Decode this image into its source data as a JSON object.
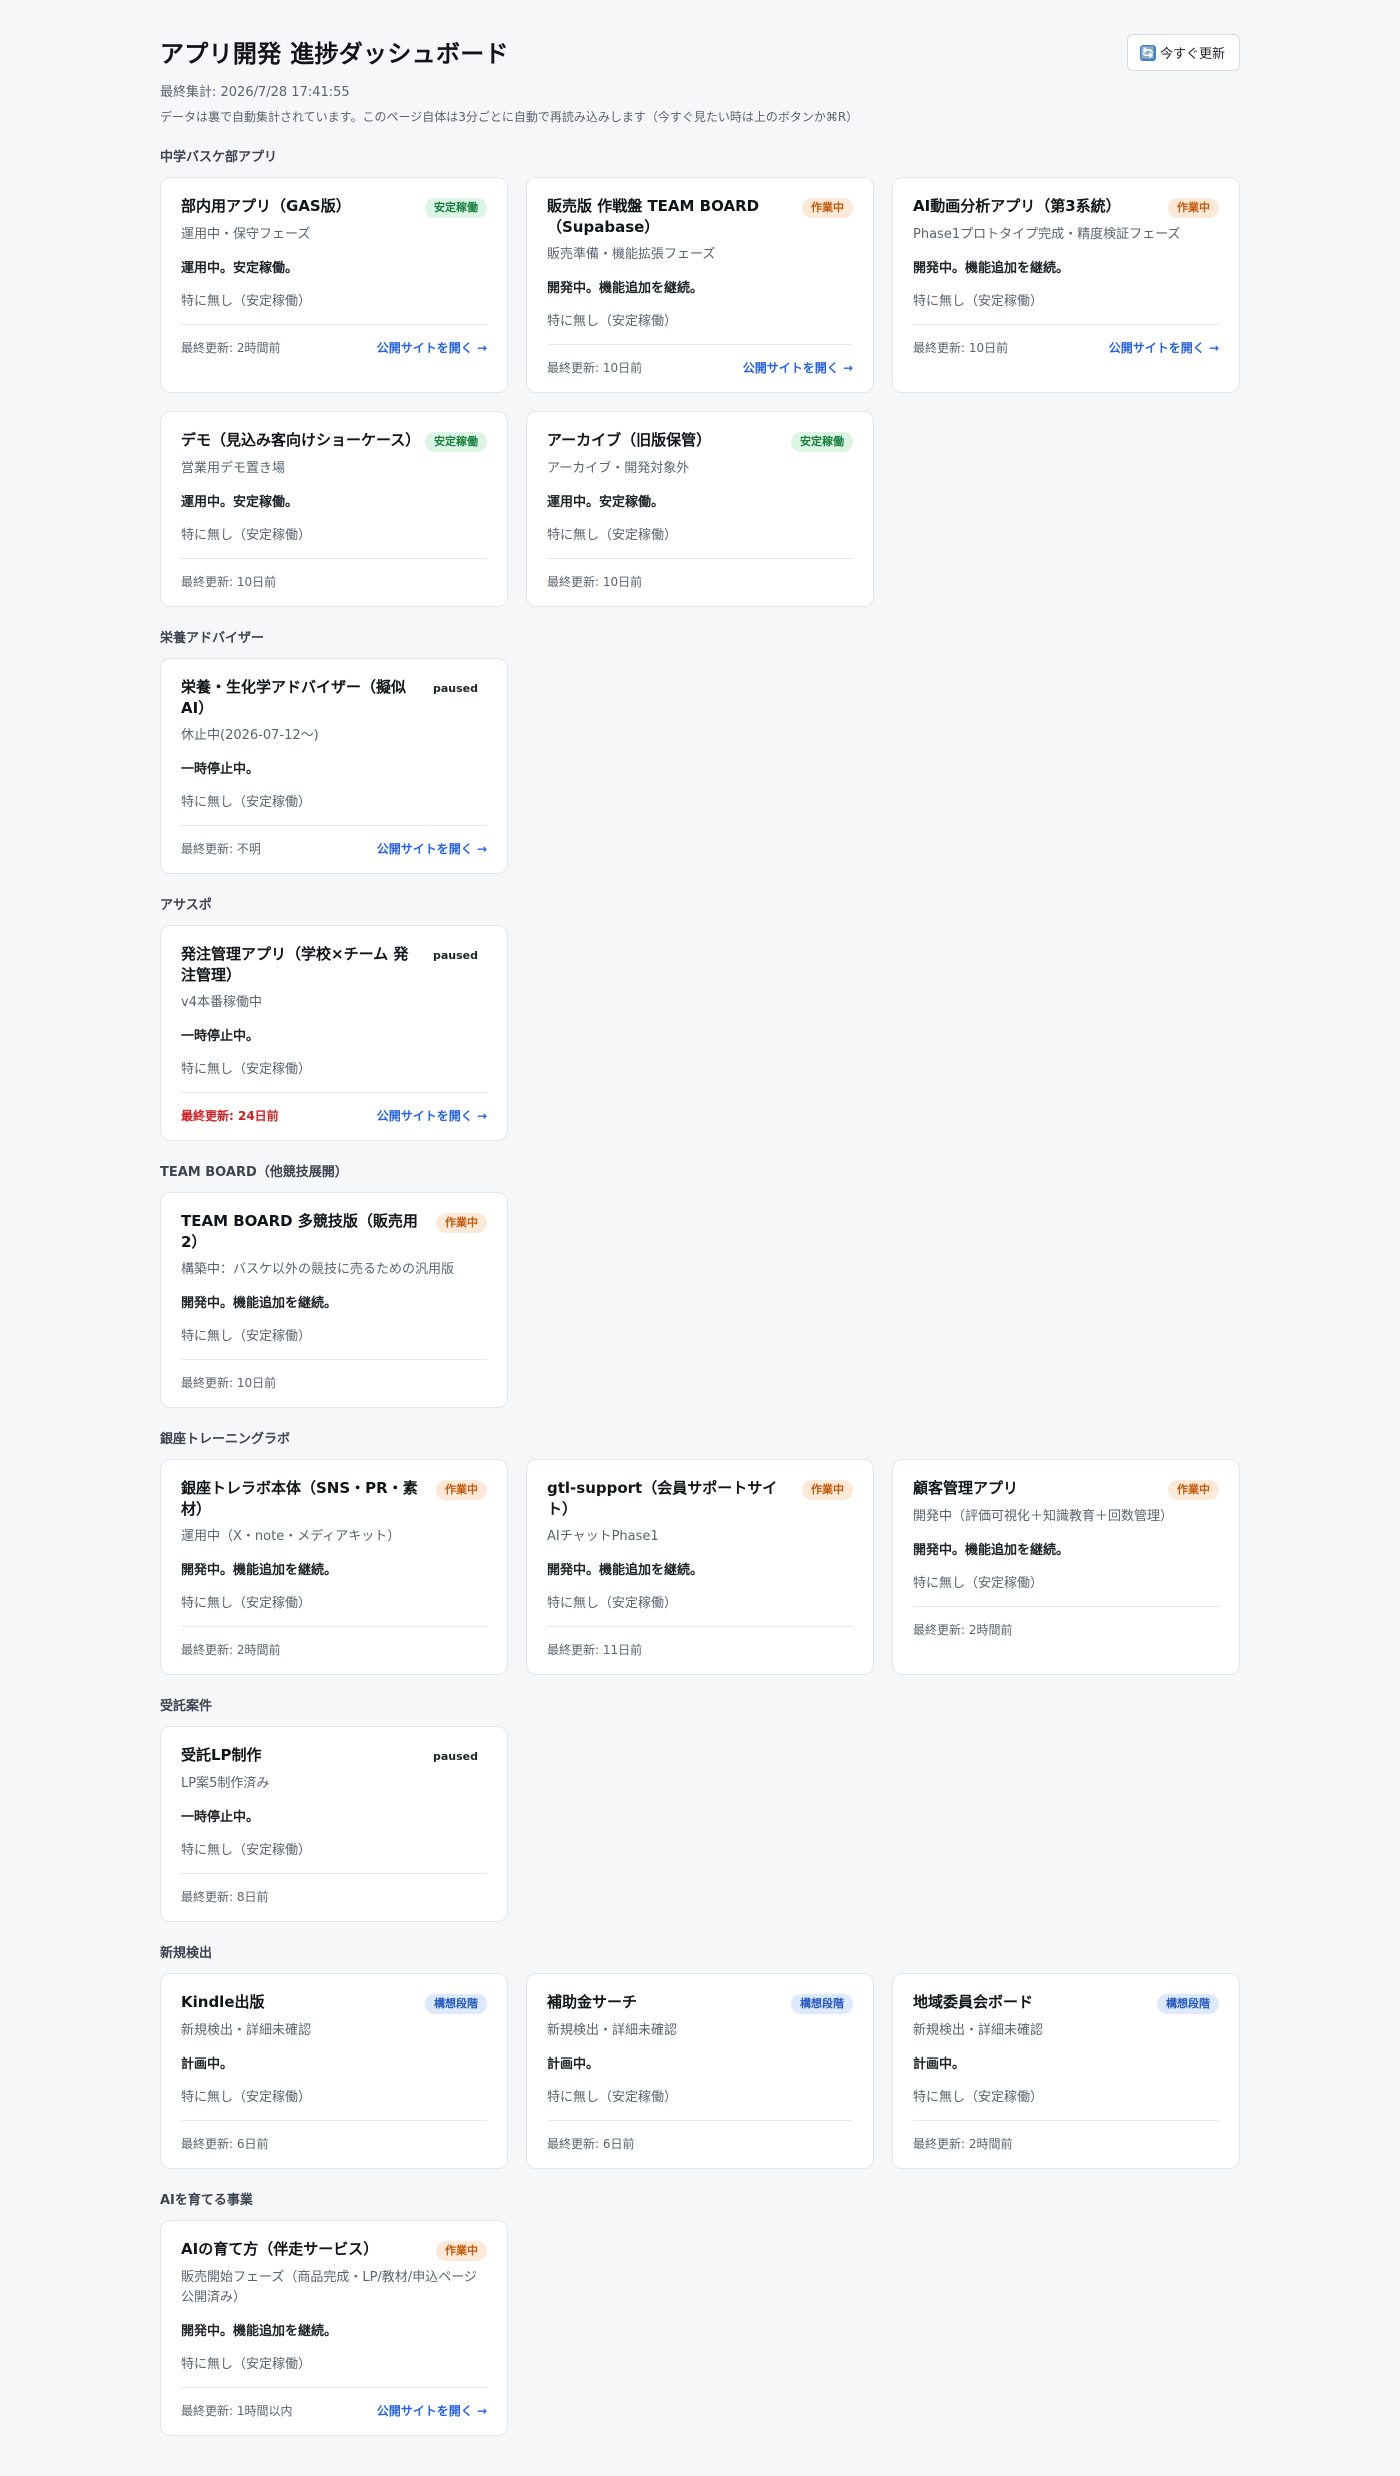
{
  "header": {
    "title": "アプリ開発 進捗ダッシュボード",
    "last_aggregated": "最終集計: 2026/7/28 17:41:55",
    "note": "データは裏で自動集計されています。このページ自体は3分ごとに自動で再読み込みします（今すぐ見たい時は上のボタンか⌘R）",
    "refresh_icon": "🔄",
    "refresh_label": "今すぐ更新"
  },
  "sections": [
    {
      "title": "中学バスケ部アプリ",
      "cards": [
        {
          "title": "部内用アプリ（GAS版）",
          "badge": "安定稼働",
          "badge_type": "stable",
          "phase": "運用中・保守フェーズ",
          "status": "運用中。安定稼働。",
          "issue": "特に無し（安定稼働）",
          "updated": "最終更新: 2時間前",
          "stale": false,
          "link": "公開サイトを開く →"
        },
        {
          "title": "販売版 作戦盤 TEAM BOARD（Supabase）",
          "badge": "作業中",
          "badge_type": "working",
          "phase": "販売準備・機能拡張フェーズ",
          "status": "開発中。機能追加を継続。",
          "issue": "特に無し（安定稼働）",
          "updated": "最終更新: 10日前",
          "stale": false,
          "link": "公開サイトを開く →"
        },
        {
          "title": "AI動画分析アプリ（第3系統）",
          "badge": "作業中",
          "badge_type": "working",
          "phase": "Phase1プロトタイプ完成・精度検証フェーズ",
          "status": "開発中。機能追加を継続。",
          "issue": "特に無し（安定稼働）",
          "updated": "最終更新: 10日前",
          "stale": false,
          "link": "公開サイトを開く →"
        },
        {
          "title": "デモ（見込み客向けショーケース）",
          "badge": "安定稼働",
          "badge_type": "stable",
          "phase": "営業用デモ置き場",
          "status": "運用中。安定稼働。",
          "issue": "特に無し（安定稼働）",
          "updated": "最終更新: 10日前",
          "stale": false,
          "link": ""
        },
        {
          "title": "アーカイブ（旧版保管）",
          "badge": "安定稼働",
          "badge_type": "stable",
          "phase": "アーカイブ・開発対象外",
          "status": "運用中。安定稼働。",
          "issue": "特に無し（安定稼働）",
          "updated": "最終更新: 10日前",
          "stale": false,
          "link": ""
        }
      ]
    },
    {
      "title": "栄養アドバイザー",
      "cards": [
        {
          "title": "栄養・生化学アドバイザー（擬似AI）",
          "badge": "paused",
          "badge_type": "paused",
          "phase": "休止中(2026-07-12〜)",
          "status": "一時停止中。",
          "issue": "特に無し（安定稼働）",
          "updated": "最終更新: 不明",
          "stale": false,
          "link": "公開サイトを開く →"
        }
      ]
    },
    {
      "title": "アサスポ",
      "cards": [
        {
          "title": "発注管理アプリ（学校×チーム 発注管理）",
          "badge": "paused",
          "badge_type": "paused",
          "phase": "v4本番稼働中",
          "status": "一時停止中。",
          "issue": "特に無し（安定稼働）",
          "updated": "最終更新: 24日前",
          "stale": true,
          "link": "公開サイトを開く →"
        }
      ]
    },
    {
      "title": "TEAM BOARD（他競技展開）",
      "cards": [
        {
          "title": "TEAM BOARD 多競技版（販売用2）",
          "badge": "作業中",
          "badge_type": "working",
          "phase": "構築中：バスケ以外の競技に売るための汎用版",
          "status": "開発中。機能追加を継続。",
          "issue": "特に無し（安定稼働）",
          "updated": "最終更新: 10日前",
          "stale": false,
          "link": ""
        }
      ]
    },
    {
      "title": "銀座トレーニングラボ",
      "cards": [
        {
          "title": "銀座トレラボ本体（SNS・PR・素材）",
          "badge": "作業中",
          "badge_type": "working",
          "phase": "運用中（X・note・メディアキット）",
          "status": "開発中。機能追加を継続。",
          "issue": "特に無し（安定稼働）",
          "updated": "最終更新: 2時間前",
          "stale": false,
          "link": ""
        },
        {
          "title": "gtl-support（会員サポートサイト）",
          "badge": "作業中",
          "badge_type": "working",
          "phase": "AIチャットPhase1",
          "status": "開発中。機能追加を継続。",
          "issue": "特に無し（安定稼働）",
          "updated": "最終更新: 11日前",
          "stale": false,
          "link": ""
        },
        {
          "title": "顧客管理アプリ",
          "badge": "作業中",
          "badge_type": "working",
          "phase": "開発中（評価可視化＋知識教育＋回数管理）",
          "status": "開発中。機能追加を継続。",
          "issue": "特に無し（安定稼働）",
          "updated": "最終更新: 2時間前",
          "stale": false,
          "link": ""
        }
      ]
    },
    {
      "title": "受託案件",
      "cards": [
        {
          "title": "受託LP制作",
          "badge": "paused",
          "badge_type": "paused",
          "phase": "LP案5制作済み",
          "status": "一時停止中。",
          "issue": "特に無し（安定稼働）",
          "updated": "最終更新: 8日前",
          "stale": false,
          "link": ""
        }
      ]
    },
    {
      "title": "新規検出",
      "cards": [
        {
          "title": "Kindle出版",
          "badge": "構想段階",
          "badge_type": "concept",
          "phase": "新規検出・詳細未確認",
          "status": "計画中。",
          "issue": "特に無し（安定稼働）",
          "updated": "最終更新: 6日前",
          "stale": false,
          "link": ""
        },
        {
          "title": "補助金サーチ",
          "badge": "構想段階",
          "badge_type": "concept",
          "phase": "新規検出・詳細未確認",
          "status": "計画中。",
          "issue": "特に無し（安定稼働）",
          "updated": "最終更新: 6日前",
          "stale": false,
          "link": ""
        },
        {
          "title": "地域委員会ボード",
          "badge": "構想段階",
          "badge_type": "concept",
          "phase": "新規検出・詳細未確認",
          "status": "計画中。",
          "issue": "特に無し（安定稼働）",
          "updated": "最終更新: 2時間前",
          "stale": false,
          "link": ""
        }
      ]
    },
    {
      "title": "AIを育てる事業",
      "cards": [
        {
          "title": "AIの育て方（伴走サービス）",
          "badge": "作業中",
          "badge_type": "working",
          "phase": "販売開始フェーズ（商品完成・LP/教材/申込ページ公開済み）",
          "status": "開発中。機能追加を継続。",
          "issue": "特に無し（安定稼働）",
          "updated": "最終更新: 1時間以内",
          "stale": false,
          "link": "公開サイトを開く →"
        }
      ]
    }
  ]
}
